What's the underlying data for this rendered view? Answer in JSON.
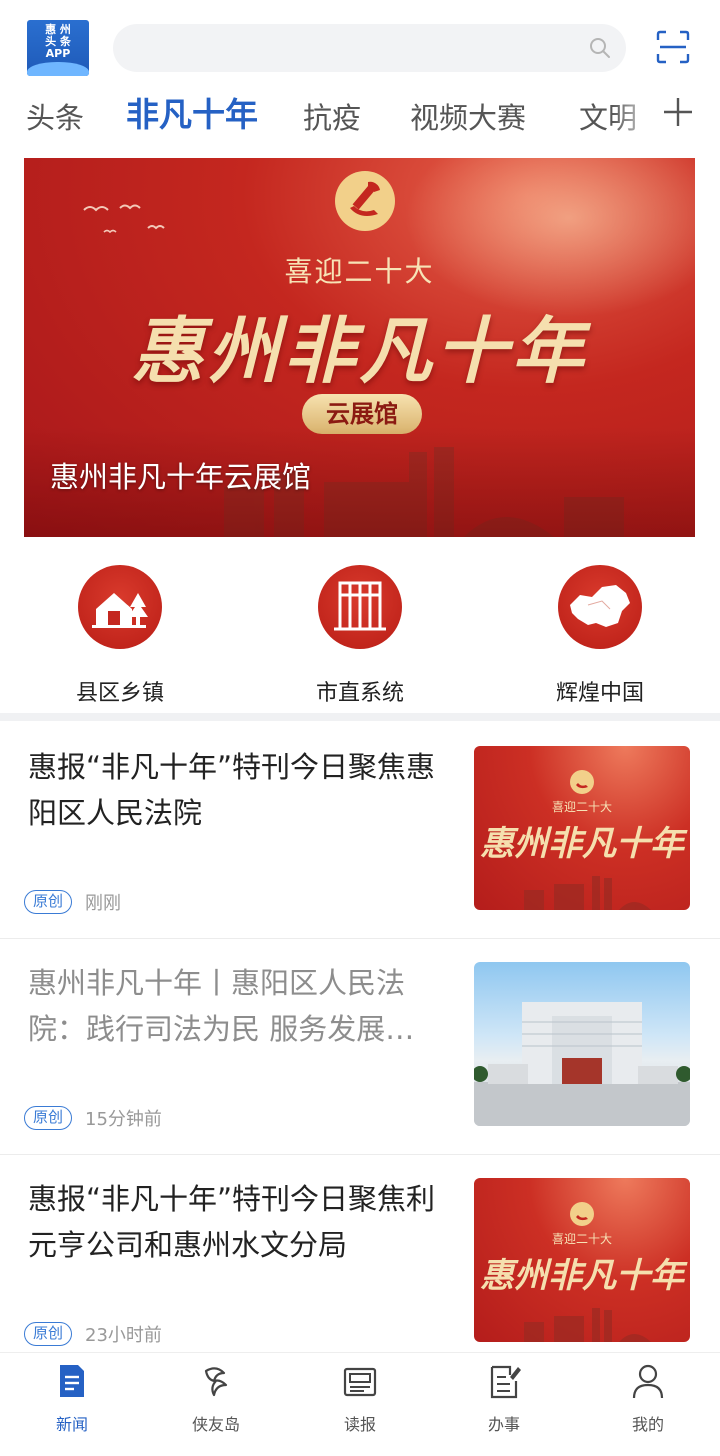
{
  "header": {
    "logo_line1": "惠 州",
    "logo_line2": "头 条",
    "logo_line3": "APP",
    "search_placeholder": ""
  },
  "tabs": [
    {
      "label": "头条"
    },
    {
      "label": "非凡十年"
    },
    {
      "label": "抗疫"
    },
    {
      "label": "视频大赛"
    },
    {
      "label": "文明"
    }
  ],
  "banner": {
    "subtitle": "喜迎二十大",
    "main": "惠州非凡十年",
    "pill": "云展馆",
    "caption": "惠州非凡十年云展馆"
  },
  "quick_entries": [
    {
      "label": "县区乡镇",
      "icon": "house-tree-icon"
    },
    {
      "label": "市直系统",
      "icon": "building-icon"
    },
    {
      "label": "辉煌中国",
      "icon": "china-map-icon"
    }
  ],
  "news": [
    {
      "title": "惠报“非凡十年”特刊今日聚焦惠阳区人民法院",
      "badge": "原创",
      "time": "刚刚",
      "read": false,
      "thumb": "poster"
    },
    {
      "title": "惠州非凡十年丨惠阳区人民法院：践行司法为民 服务发展…",
      "badge": "原创",
      "time": "15分钟前",
      "read": true,
      "thumb": "photo"
    },
    {
      "title": "惠报“非凡十年”特刊今日聚焦利元亨公司和惠州水文分局",
      "badge": "原创",
      "time": "23小时前",
      "read": false,
      "thumb": "poster"
    }
  ],
  "thumb_poster": {
    "subtitle": "喜迎二十大",
    "main": "惠州非凡十年"
  },
  "bottom_nav": [
    {
      "label": "新闻",
      "icon": "news-icon",
      "active": true
    },
    {
      "label": "侠友岛",
      "icon": "island-icon",
      "active": false
    },
    {
      "label": "读报",
      "icon": "newspaper-icon",
      "active": false
    },
    {
      "label": "办事",
      "icon": "task-icon",
      "active": false
    },
    {
      "label": "我的",
      "icon": "profile-icon",
      "active": false
    }
  ],
  "colors": {
    "accent": "#2561c4",
    "banner_red": "#c4271f",
    "gold": "#f5dfae"
  }
}
